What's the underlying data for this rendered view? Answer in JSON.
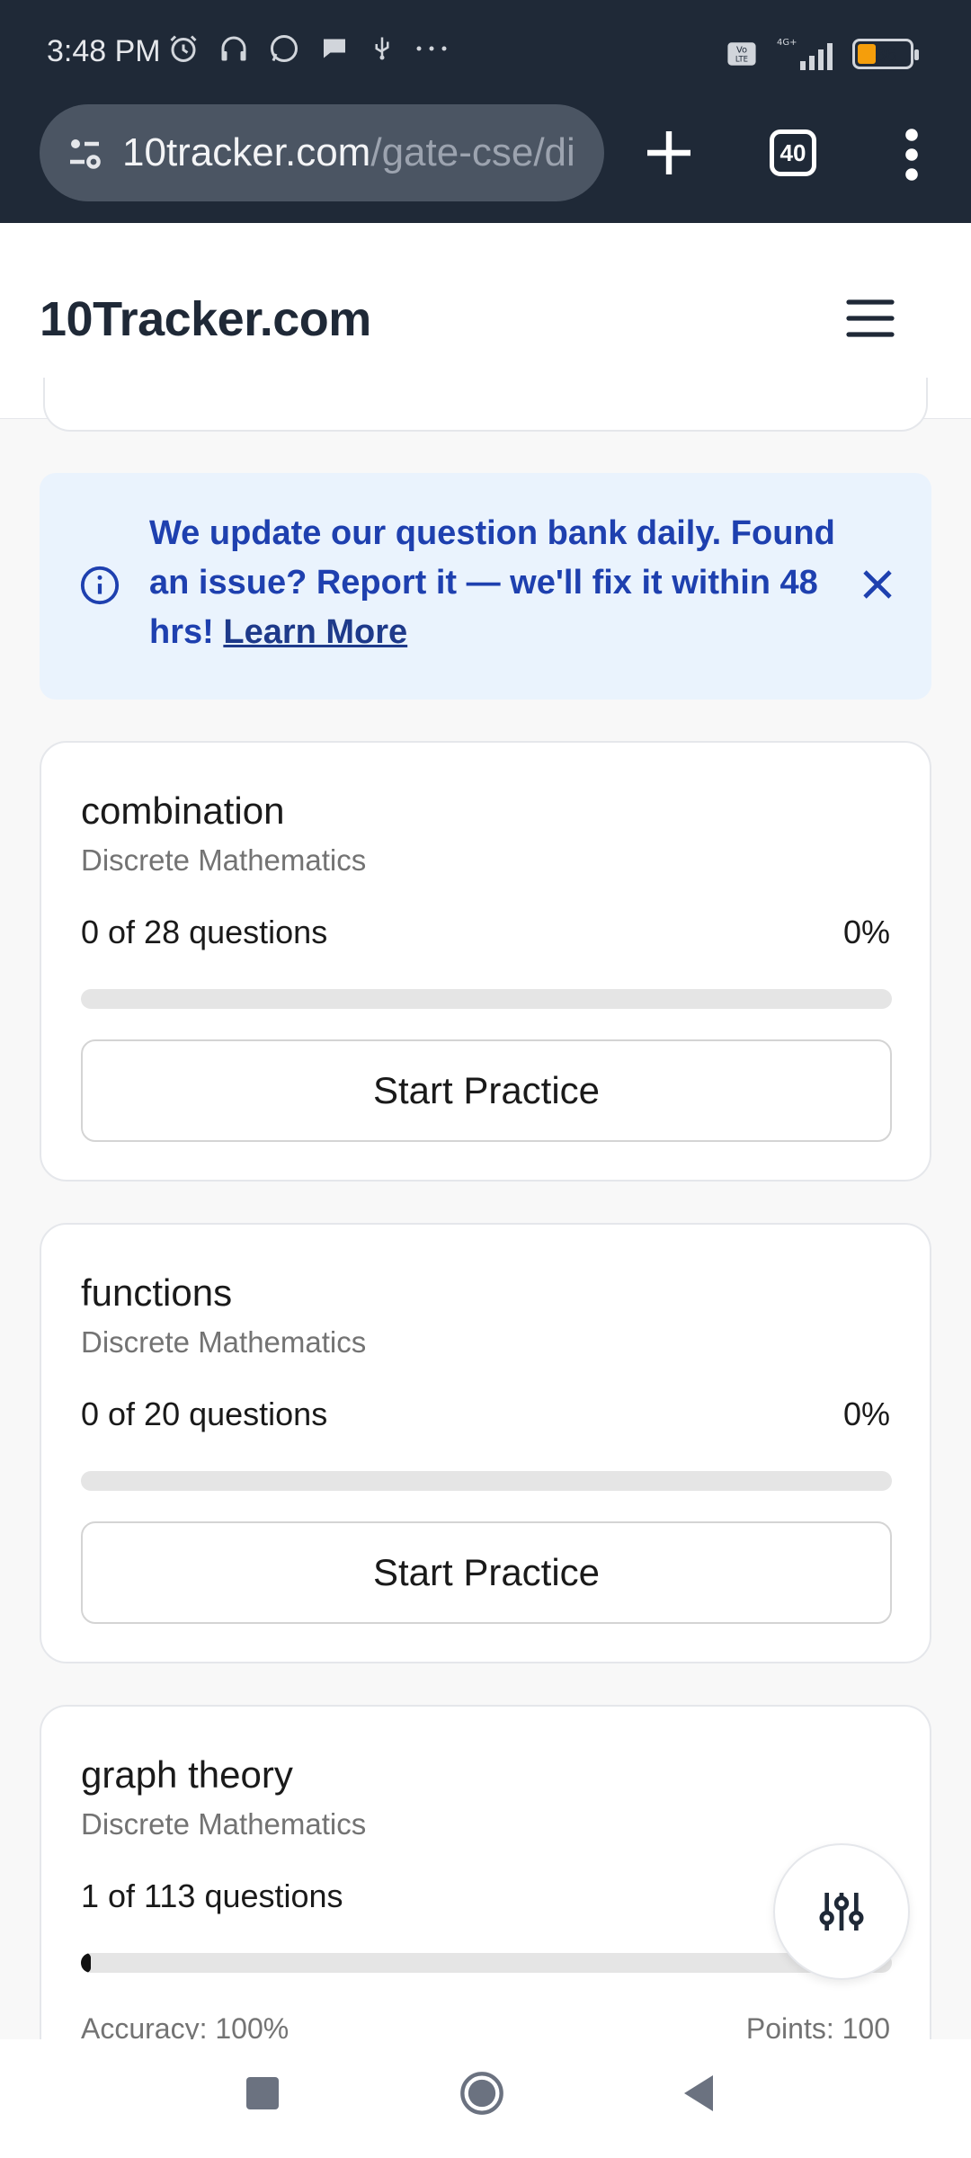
{
  "status_bar": {
    "time": "3:48 PM",
    "battery": "36",
    "network": "4G+"
  },
  "browser": {
    "url_domain": "10tracker.com",
    "url_path": "/gate-cse/di",
    "tab_count": "40"
  },
  "site": {
    "logo": "10Tracker.com"
  },
  "alert": {
    "message": "We update our question bank daily. Found an issue? Report it — we'll fix it within 48 hrs!",
    "link": "Learn More"
  },
  "cards": [
    {
      "title": "combination",
      "subject": "Discrete Mathematics",
      "progress_text": "0 of 28 questions",
      "percent": "0%",
      "progress": 0,
      "button": "Start Practice"
    },
    {
      "title": "functions",
      "subject": "Discrete Mathematics",
      "progress_text": "0 of 20 questions",
      "percent": "0%",
      "progress": 0,
      "button": "Start Practice"
    },
    {
      "title": "graph theory",
      "subject": "Discrete Mathematics",
      "progress_text": "1 of 113 questions",
      "progress": 0.009,
      "accuracy": "Accuracy: 100%",
      "points": "Points: 100"
    }
  ],
  "colors": {
    "chrome": "#1f2937",
    "alert_bg": "#eaf3fd",
    "alert_text": "#1e40af"
  }
}
